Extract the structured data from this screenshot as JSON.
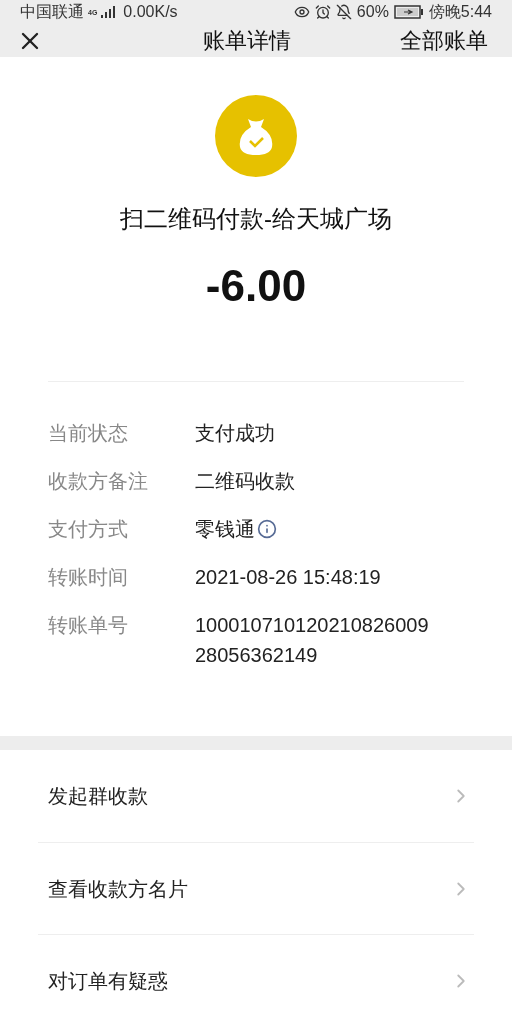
{
  "status_bar": {
    "carrier": "中国联通",
    "network": "4G",
    "speed": "0.00K/s",
    "battery": "60%",
    "time": "傍晚5:44"
  },
  "header": {
    "title": "账单详情",
    "action": "全部账单"
  },
  "summary": {
    "title": "扫二维码付款-给天城广场",
    "amount": "-6.00"
  },
  "details": [
    {
      "label": "当前状态",
      "value": "支付成功",
      "info": false
    },
    {
      "label": "收款方备注",
      "value": "二维码收款",
      "info": false
    },
    {
      "label": "支付方式",
      "value": "零钱通",
      "info": true
    },
    {
      "label": "转账时间",
      "value": "2021-08-26 15:48:19",
      "info": false
    },
    {
      "label": "转账单号",
      "value": "10001071012021082600928056362149",
      "info": false
    }
  ],
  "actions": [
    {
      "label": "发起群收款"
    },
    {
      "label": "查看收款方名片"
    },
    {
      "label": "对订单有疑惑"
    }
  ]
}
